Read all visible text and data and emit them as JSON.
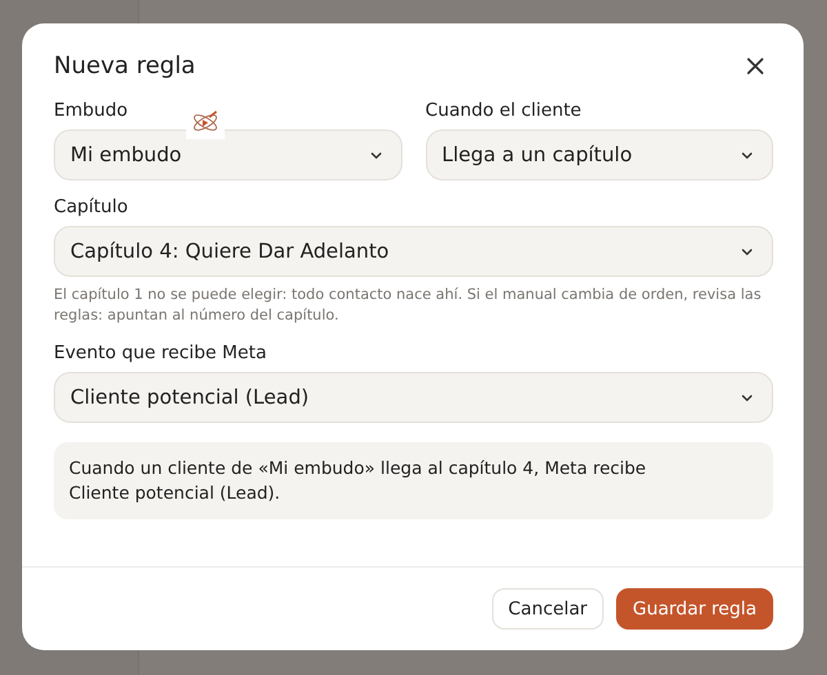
{
  "dialog": {
    "title": "Nueva regla",
    "fields": [
      {
        "label": "Embudo",
        "value": "Mi embudo",
        "wide": false
      },
      {
        "label": "Cuando el cliente",
        "value": "Llega a un capítulo",
        "wide": false
      },
      {
        "label": "Capítulo",
        "value": "Capítulo 4: Quiere Dar Adelanto",
        "wide": true,
        "help": "El capítulo 1 no se puede elegir: todo contacto nace ahí. Si el manual cambia de orden, revisa las reglas: apuntan al número del capítulo."
      },
      {
        "label": "Evento que recibe Meta",
        "value": "Cliente potencial (Lead)",
        "wide": true
      }
    ],
    "summary": "Cuando un cliente de «Mi embudo» llega al capítulo 4, Meta recibe Cliente potencial (Lead).",
    "buttons": [
      {
        "label": "Cancelar",
        "kind": "secondary"
      },
      {
        "label": "Guardar regla",
        "kind": "primary"
      }
    ]
  }
}
